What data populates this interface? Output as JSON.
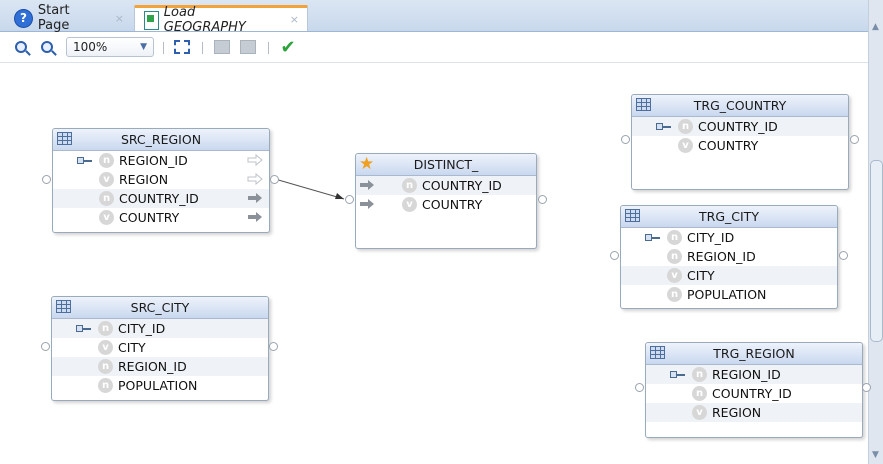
{
  "tabs": [
    {
      "label": "Start Page",
      "close": "×"
    },
    {
      "label": "Load GEOGRAPHY",
      "close": "×"
    }
  ],
  "toolbar": {
    "zoom_value": "100%",
    "help_glyph": "?"
  },
  "icons": {
    "help": "help-icon",
    "zoom_in": "zoom-in-icon",
    "zoom_out": "zoom-out-icon",
    "fit": "fit-to-window-icon",
    "validate": "checkmark-icon",
    "table": "table-icon",
    "key": "key-icon",
    "star": "star-icon"
  },
  "datatype_glyphs": {
    "n": "n",
    "v": "v"
  },
  "colors": {
    "tab_active_accent": "#f3a23a",
    "entity_header": "#c9d8ef",
    "check": "#2aa33a",
    "help": "#2f6fd6"
  },
  "entities": {
    "src_region": {
      "title": "SRC_REGION",
      "attributes": [
        {
          "name": "REGION_ID",
          "type": "n",
          "key": true,
          "arrow": "outline"
        },
        {
          "name": "REGION",
          "type": "v",
          "key": false,
          "arrow": "outline"
        },
        {
          "name": "COUNTRY_ID",
          "type": "n",
          "key": false,
          "arrow": "solid"
        },
        {
          "name": "COUNTRY",
          "type": "v",
          "key": false,
          "arrow": "solid"
        }
      ]
    },
    "src_city": {
      "title": "SRC_CITY",
      "attributes": [
        {
          "name": "CITY_ID",
          "type": "n",
          "key": true
        },
        {
          "name": "CITY",
          "type": "v",
          "key": false
        },
        {
          "name": "REGION_ID",
          "type": "n",
          "key": false
        },
        {
          "name": "POPULATION",
          "type": "n",
          "key": false
        }
      ]
    },
    "distinct": {
      "title": "DISTINCT_",
      "attributes": [
        {
          "name": "COUNTRY_ID",
          "type": "n"
        },
        {
          "name": "COUNTRY",
          "type": "v"
        }
      ]
    },
    "trg_country": {
      "title": "TRG_COUNTRY",
      "attributes": [
        {
          "name": "COUNTRY_ID",
          "type": "n",
          "key": true
        },
        {
          "name": "COUNTRY",
          "type": "v",
          "key": false
        }
      ]
    },
    "trg_city": {
      "title": "TRG_CITY",
      "attributes": [
        {
          "name": "CITY_ID",
          "type": "n",
          "key": true
        },
        {
          "name": "REGION_ID",
          "type": "n",
          "key": false
        },
        {
          "name": "CITY",
          "type": "v",
          "key": false
        },
        {
          "name": "POPULATION",
          "type": "n",
          "key": false
        }
      ]
    },
    "trg_region": {
      "title": "TRG_REGION",
      "attributes": [
        {
          "name": "REGION_ID",
          "type": "n",
          "key": true
        },
        {
          "name": "COUNTRY_ID",
          "type": "n",
          "key": false
        },
        {
          "name": "REGION",
          "type": "v",
          "key": false
        }
      ]
    }
  }
}
